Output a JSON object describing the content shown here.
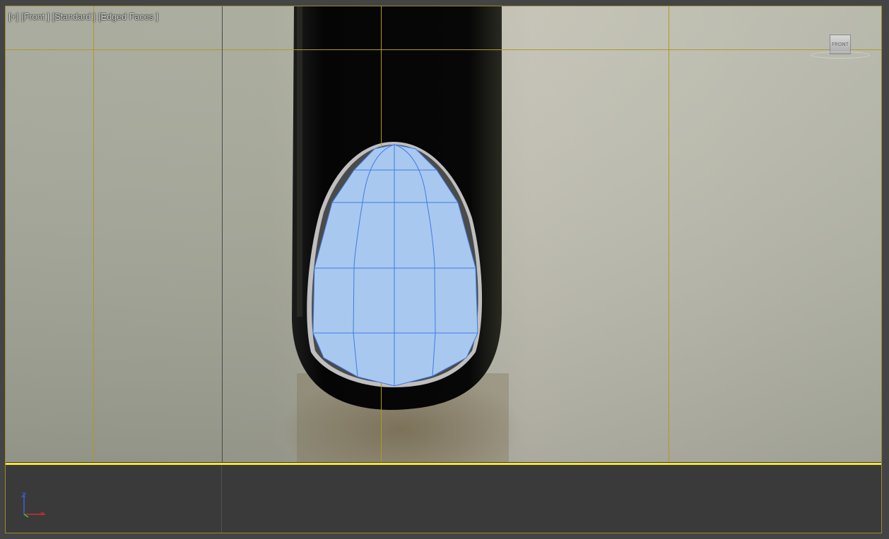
{
  "viewport": {
    "labels": [
      "[+]",
      "[Front ]",
      "[Standard ]",
      "[Edged Faces ]"
    ]
  },
  "viewcube": {
    "face_label": "FRONT"
  },
  "colors": {
    "grid_line": "#b09a1e",
    "active_border": "#f4e43a",
    "mesh_fill": "#a9c8f0",
    "mesh_edge": "#3f7be0",
    "background_wall": "#a9ab9c",
    "handle_dark": "#0d0d0d",
    "axis_x": "#d62a2a",
    "axis_y": "#2ecc3d",
    "axis_z": "#3a5fe0"
  },
  "axis_tripod": {
    "icon": "xyz-axis-icon"
  }
}
